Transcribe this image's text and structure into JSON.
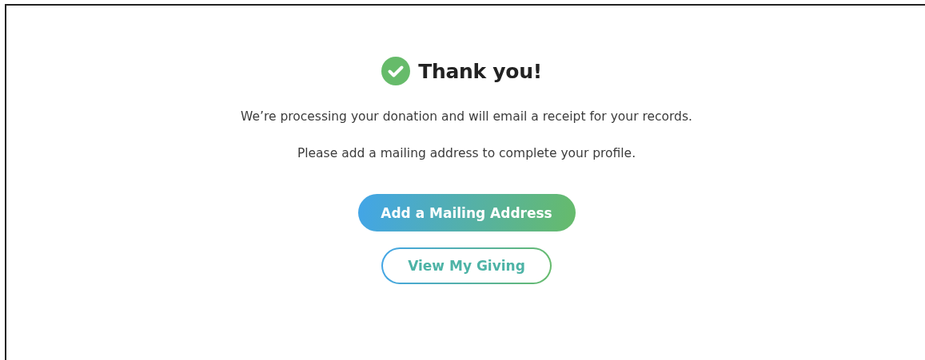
{
  "confirmation": {
    "title": "Thank you!",
    "messages": [
      "We’re processing your donation and will email a receipt for your records.",
      "Please add a mailing address to complete your profile."
    ],
    "buttons": [
      {
        "label": "Add a Mailing Address",
        "kind": "primary"
      },
      {
        "label": "View My Giving",
        "kind": "secondary"
      }
    ]
  }
}
